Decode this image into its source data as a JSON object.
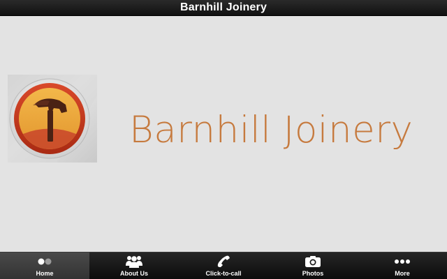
{
  "header": {
    "title": "Barnhill Joinery"
  },
  "main": {
    "brand_name": "Barnhill Joinery",
    "colors": {
      "brand_text": "#c67a3e",
      "logo_ring_outer": "#c33a1c",
      "logo_fill": "#e8a33a"
    }
  },
  "tabbar": {
    "active_tab": "home",
    "tabs": [
      {
        "id": "home",
        "label": "Home",
        "icon": "dots-icon"
      },
      {
        "id": "about",
        "label": "About Us",
        "icon": "people-icon"
      },
      {
        "id": "call",
        "label": "Click-to-call",
        "icon": "phone-icon"
      },
      {
        "id": "photos",
        "label": "Photos",
        "icon": "camera-icon"
      },
      {
        "id": "more",
        "label": "More",
        "icon": "more-dots-icon"
      }
    ]
  }
}
